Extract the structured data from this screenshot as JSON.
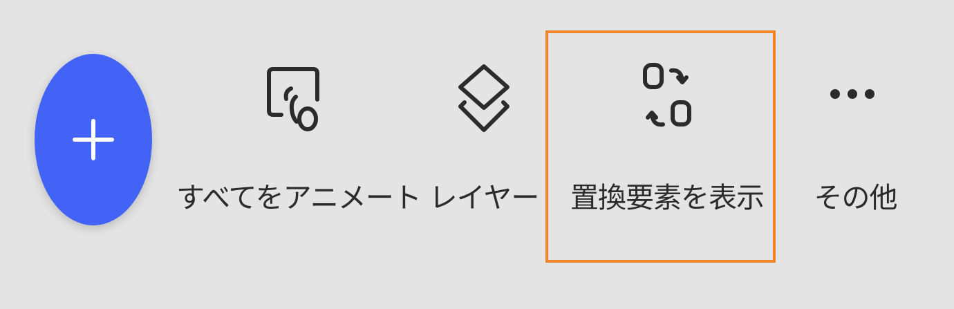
{
  "toolbar": {
    "add_button": {
      "icon": "plus-icon",
      "color": "#4263f5"
    },
    "items": [
      {
        "label": "すべてをアニメート",
        "icon": "animate-all-icon"
      },
      {
        "label": "レイヤー",
        "icon": "layers-icon"
      },
      {
        "label": "置換要素を表示",
        "icon": "swap-elements-icon",
        "highlighted": true
      },
      {
        "label": "その他",
        "icon": "more-icon"
      }
    ],
    "highlight_color": "#f0842a"
  }
}
